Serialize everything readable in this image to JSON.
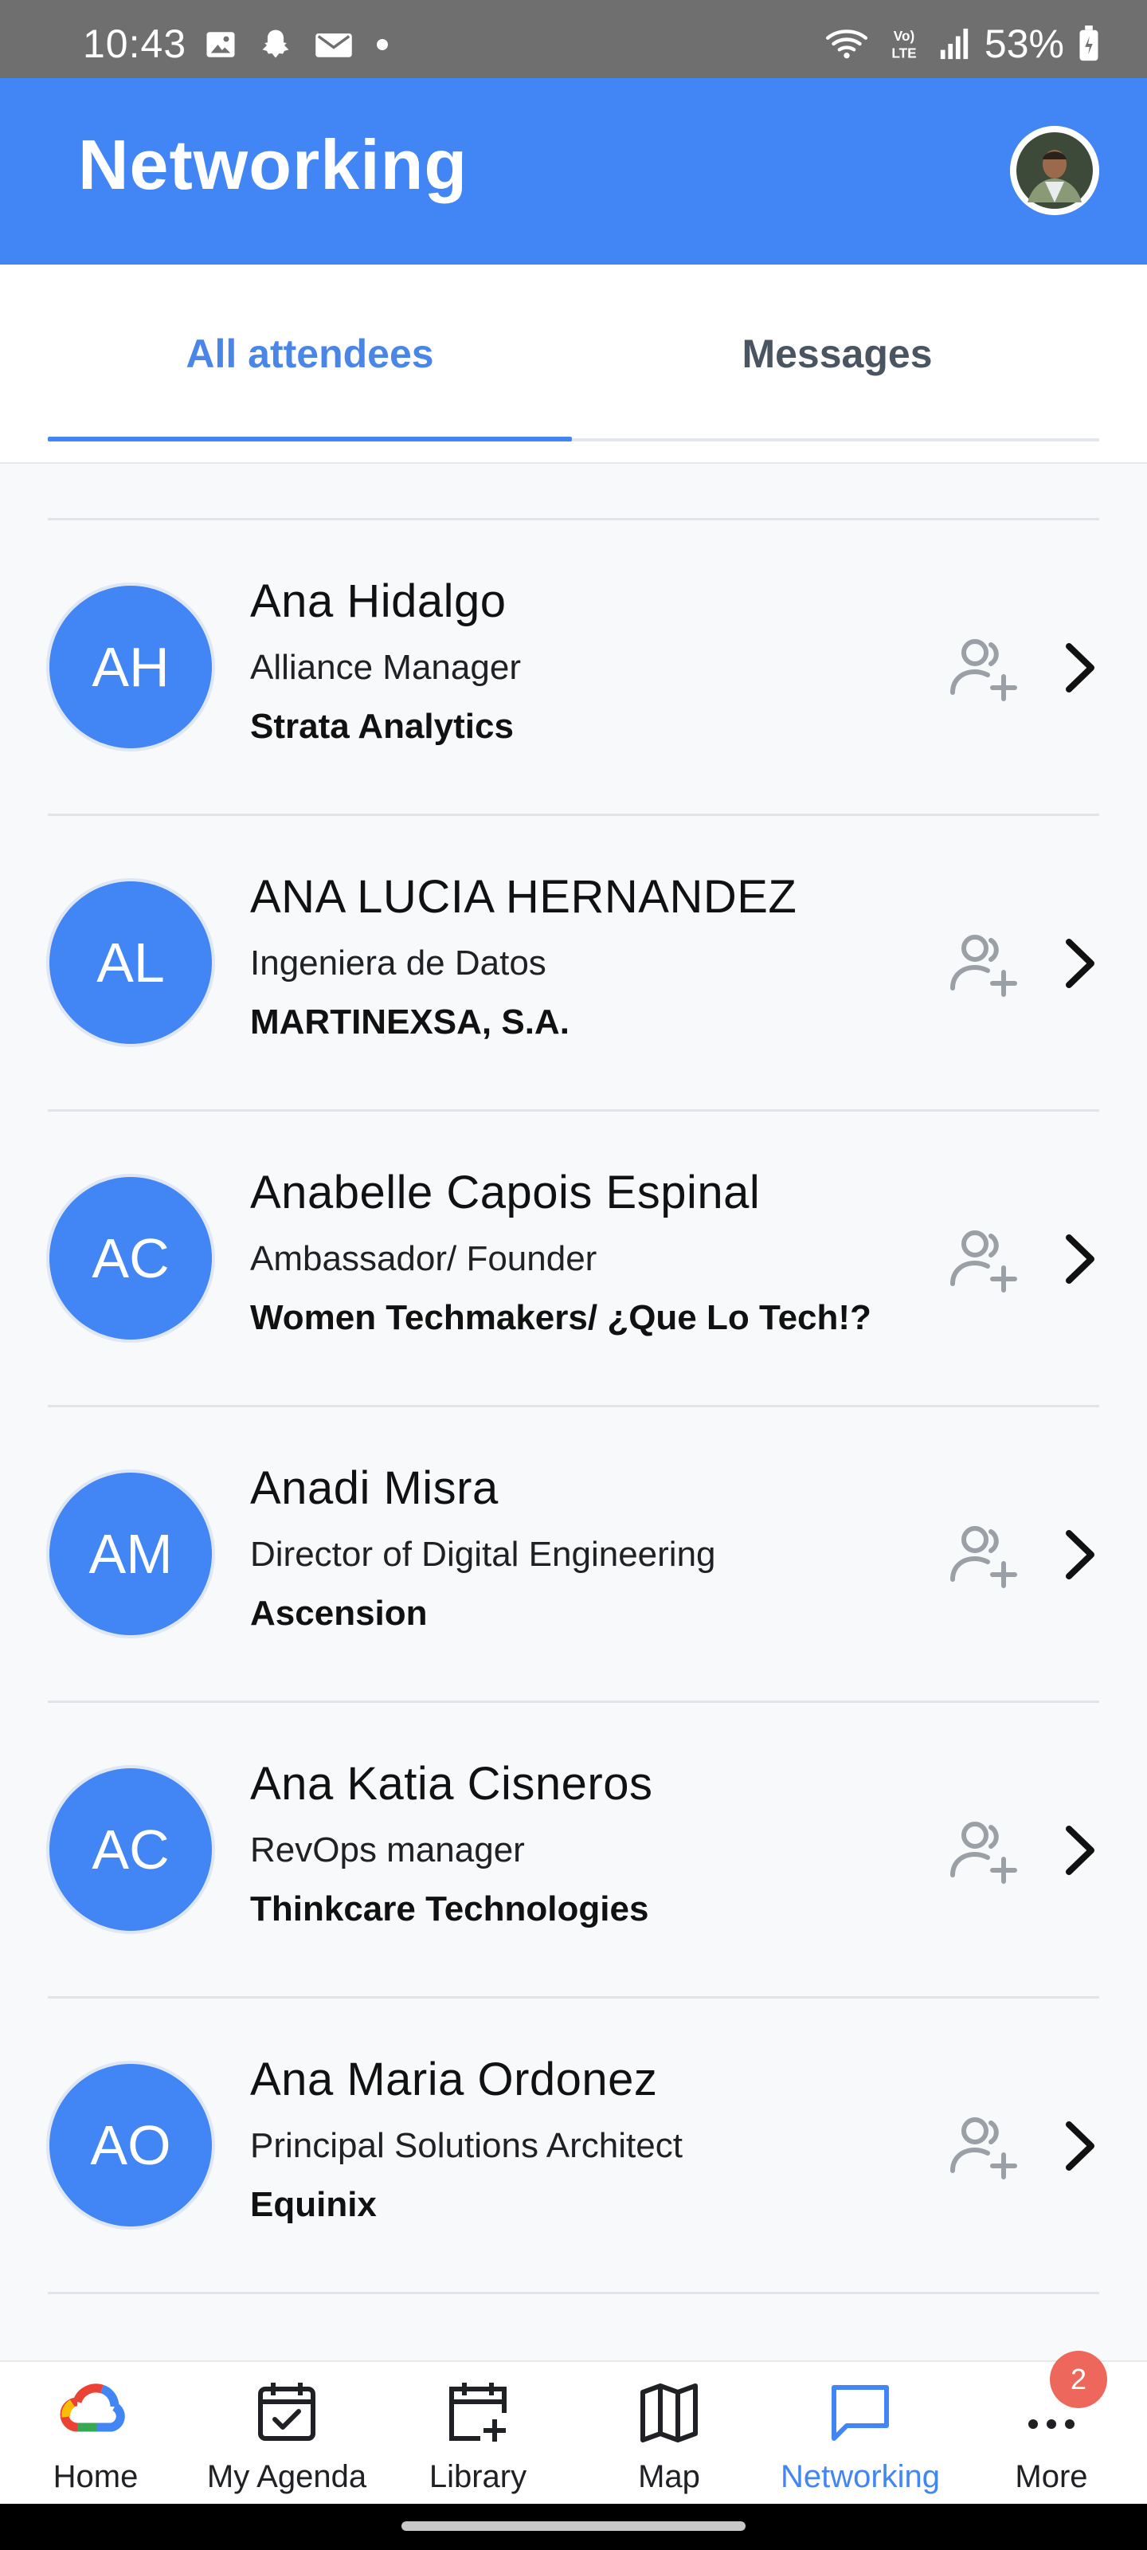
{
  "status_bar": {
    "time": "10:43",
    "battery": "53%",
    "icons": [
      "gallery-icon",
      "snapchat-icon",
      "email-icon",
      "dot-icon",
      "wifi-icon",
      "volte-icon",
      "signal-icon",
      "battery-icon"
    ]
  },
  "app_bar": {
    "title": "Networking"
  },
  "tabs": [
    {
      "label": "All attendees",
      "active": true
    },
    {
      "label": "Messages",
      "active": false
    }
  ],
  "attendees": [
    {
      "initials": "AH",
      "name": "Ana Hidalgo",
      "role": "Alliance Manager",
      "company": "Strata Analytics"
    },
    {
      "initials": "AL",
      "name": "ANA LUCIA HERNANDEZ",
      "role": "Ingeniera de Datos",
      "company": "MARTINEXSA, S.A."
    },
    {
      "initials": "AC",
      "name": "Anabelle Capois Espinal",
      "role": "Ambassador/ Founder",
      "company": "Women Techmakers/ ¿Que Lo Tech!?"
    },
    {
      "initials": "AM",
      "name": "Anadi Misra",
      "role": "Director of Digital Engineering",
      "company": "Ascension"
    },
    {
      "initials": "AC",
      "name": "Ana Katia Cisneros",
      "role": "RevOps manager",
      "company": "Thinkcare Technologies"
    },
    {
      "initials": "AO",
      "name": "Ana Maria Ordonez",
      "role": "Principal Solutions Architect",
      "company": "Equinix"
    }
  ],
  "bottom_nav": {
    "items": [
      {
        "label": "Home",
        "icon": "google-cloud-icon"
      },
      {
        "label": "My Agenda",
        "icon": "calendar-check-icon"
      },
      {
        "label": "Library",
        "icon": "calendar-add-icon"
      },
      {
        "label": "Map",
        "icon": "map-icon"
      },
      {
        "label": "Networking",
        "icon": "chat-icon",
        "active": true
      },
      {
        "label": "More",
        "icon": "more-dots-icon"
      }
    ],
    "more_badge": "2"
  },
  "colors": {
    "primary": "#4285f4",
    "tab_active_text": "#4a85e8",
    "badge": "#ee675c"
  }
}
